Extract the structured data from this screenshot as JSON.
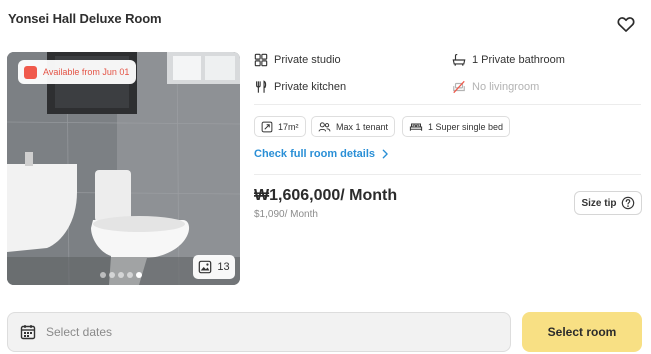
{
  "listing": {
    "title": "Yonsei Hall Deluxe Room",
    "favorite_icon": "heart-icon"
  },
  "gallery": {
    "availability": "Available from Jun 01",
    "availability_color": "#f05a4c",
    "image_count": "13",
    "dots_total": 5,
    "dot_active": 5
  },
  "amenities": [
    {
      "label": "Private studio",
      "icon": "studio-icon",
      "available": true
    },
    {
      "label": "1 Private bathroom",
      "icon": "bathtub-icon",
      "available": true
    },
    {
      "label": "Private kitchen",
      "icon": "utensils-icon",
      "available": true
    },
    {
      "label": "No livingroom",
      "icon": "sofa-crossed-icon",
      "available": false
    }
  ],
  "chips": [
    {
      "label": "17m²",
      "icon": "area-icon"
    },
    {
      "label": "Max 1 tenant",
      "icon": "users-icon"
    },
    {
      "label": "1 Super single bed",
      "icon": "bed-icon"
    }
  ],
  "details_link": "Check full room details",
  "pricing": {
    "price": "₩1,606,000/ Month",
    "secondary": "$1,090/ Month",
    "size_tip": "Size tip"
  },
  "booking": {
    "dates_placeholder": "Select dates",
    "select_button": "Select room",
    "button_color": "#f8e084"
  },
  "colors": {
    "link": "#2a8fd6",
    "accent_red": "#f05a4c"
  }
}
